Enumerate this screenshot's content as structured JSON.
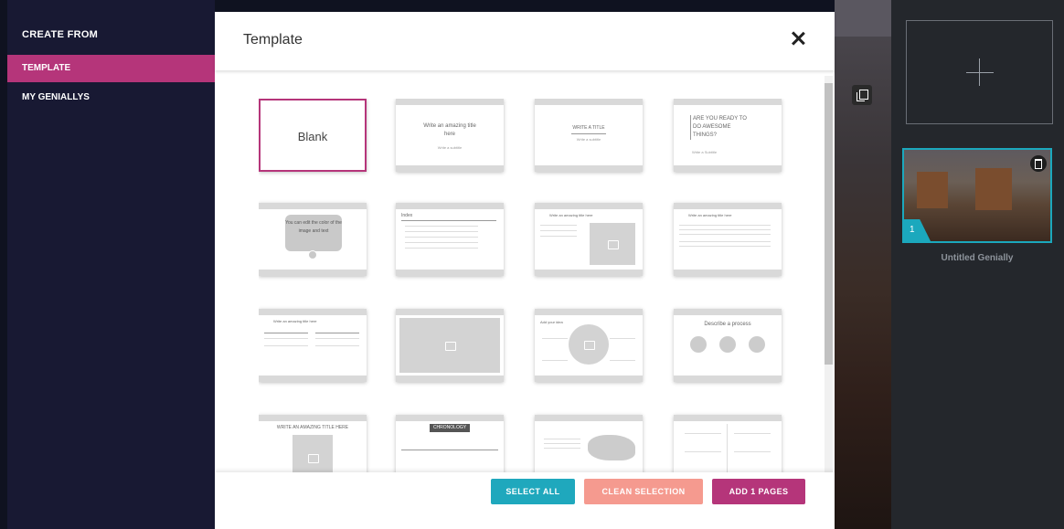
{
  "sidebar": {
    "title": "CREATE FROM",
    "items": [
      {
        "label": "TEMPLATE",
        "active": true
      },
      {
        "label": "MY GENIALLYS",
        "active": false
      }
    ]
  },
  "modal": {
    "title": "Template",
    "thumbnails": [
      {
        "name": "blank",
        "label": "Blank"
      },
      {
        "name": "title-subtitle",
        "text": "Write an amazing title here",
        "subtext": "Write a subtitle"
      },
      {
        "name": "write-a-title",
        "text": "WRITE A TITLE",
        "subtext": "Write a subtitle"
      },
      {
        "name": "are-you-ready",
        "text": "ARE YOU READY TO DO AWESOME THINGS?",
        "subtext": "Write a Subtitle"
      },
      {
        "name": "speech-bubble",
        "text": "You can edit the color of the image and text"
      },
      {
        "name": "index",
        "text": "Index"
      },
      {
        "name": "title-image",
        "text": "Write an amazing title here"
      },
      {
        "name": "title-text",
        "text": "Write an amazing title here"
      },
      {
        "name": "two-columns",
        "text": "Write an amazing title here"
      },
      {
        "name": "full-image"
      },
      {
        "name": "circle-diagram",
        "text": "Add your idea"
      },
      {
        "name": "process",
        "text": "Describe a process"
      },
      {
        "name": "title-image-big",
        "text": "WRITE AN AMAZING TITLE HERE"
      },
      {
        "name": "chronology",
        "text": "CHRONOLOGY"
      },
      {
        "name": "world-map"
      },
      {
        "name": "two-column-text"
      }
    ]
  },
  "footer": {
    "select_all": "SELECT ALL",
    "clean_selection": "CLEAN SELECTION",
    "add_pages": "ADD 1 PAGES"
  },
  "right_panel": {
    "page_number": "1",
    "page_name": "Untitled Genially"
  },
  "colors": {
    "accent": "#b5357a",
    "teal": "#1fa8bd",
    "salmon": "#f59a8f",
    "sidebar_bg": "#181933"
  }
}
